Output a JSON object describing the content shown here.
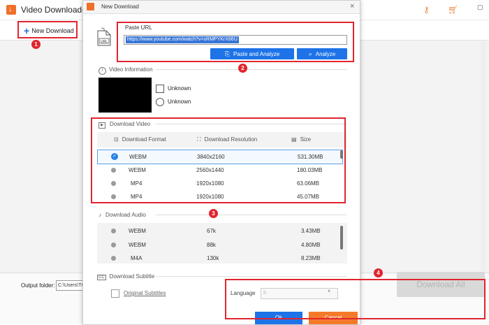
{
  "app": {
    "title": "Video Downloader",
    "new_download_label": "New Download",
    "output_folder_label": "Output folder:",
    "output_path": "C:\\Users\\TC",
    "download_all_label": "Download All"
  },
  "dialog": {
    "title": "New Download",
    "close_glyph": "×",
    "paste_url": {
      "label": "Paste URL",
      "value": "https://www.youtube.com/watch?v=sRMPYKrX86U",
      "paste_analyze_button": "Paste and Analyze",
      "analyze_button": "Analyze"
    },
    "video_info": {
      "section_title": "Video Information",
      "title_value": "Unknown",
      "duration_value": "Unknown"
    },
    "download_video": {
      "section_title": "Download Video",
      "columns": [
        "Download Format",
        "Download Resolution",
        "Size"
      ],
      "rows": [
        {
          "format": "WEBM",
          "resolution": "3840x2160",
          "size": "531.30MB",
          "selected": true
        },
        {
          "format": "WEBM",
          "resolution": "2560x1440",
          "size": "180.03MB",
          "selected": false
        },
        {
          "format": "MP4",
          "resolution": "1920x1080",
          "size": "63.06MB",
          "selected": false
        },
        {
          "format": "MP4",
          "resolution": "1920x1080",
          "size": "45.07MB",
          "selected": false
        }
      ]
    },
    "download_audio": {
      "section_title": "Download Audio",
      "rows": [
        {
          "format": "WEBM",
          "bitrate": "67k",
          "size": "3.43MB"
        },
        {
          "format": "WEBM",
          "bitrate": "88k",
          "size": "4.80MB"
        },
        {
          "format": "M4A",
          "bitrate": "130k",
          "size": "8.23MB"
        }
      ]
    },
    "subtitle": {
      "section_title": "Download Subtitle",
      "original_subtitles_label": "Original Subtitles",
      "language_label": "Language",
      "language_value": "fr"
    },
    "ok_label": "Ok",
    "cancel_label": "Cancel"
  },
  "annotations": {
    "badges": [
      "1",
      "2",
      "3",
      "4"
    ],
    "color": "#e0252f"
  },
  "colors": {
    "accent_blue": "#1e73e8",
    "cancel_orange": "#f47a2a",
    "logo_orange": "#f0702a"
  }
}
